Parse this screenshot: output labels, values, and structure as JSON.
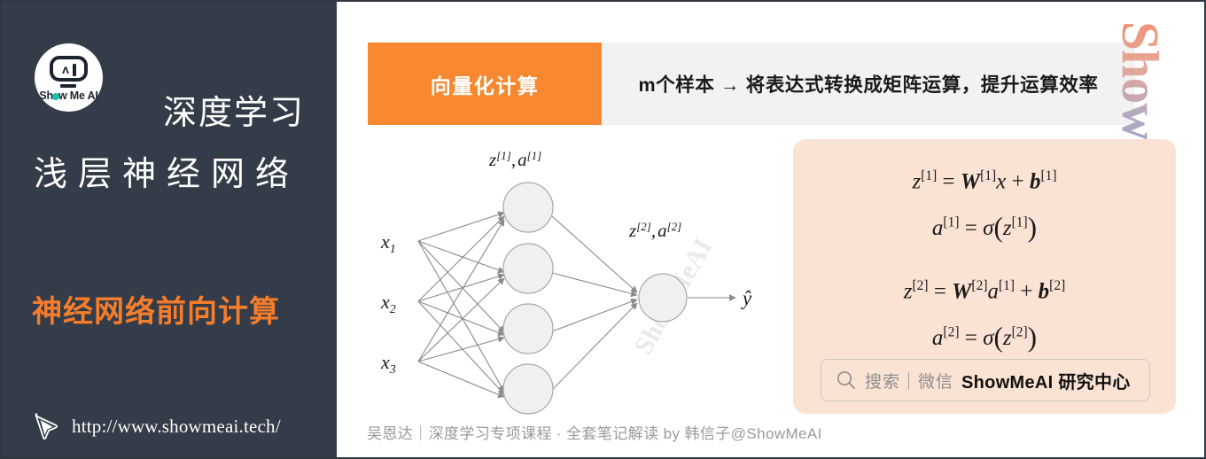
{
  "sidebar": {
    "logo": {
      "brand_prefix": "Sh",
      "brand_suffix": "w Me AI",
      "face_letter": "ʌ"
    },
    "title_main": "深度学习",
    "title_sub": "浅层神经网络",
    "title_topic": "神经网络前向计算",
    "url": "http://www.showmeai.tech/"
  },
  "banner": {
    "tag": "向量化计算",
    "description": "m个样本 → 将表达式转换成矩阵运算，提升运算效率"
  },
  "watermark": {
    "text": "ShowMeAI"
  },
  "diagram": {
    "inputs": [
      "x",
      "x",
      "x"
    ],
    "input_subscripts": [
      "1",
      "2",
      "3"
    ],
    "hidden_label_base": "z",
    "hidden_label": "z[1], a[1]",
    "output_label": "z[2], a[2]",
    "output_value": "ŷ",
    "hidden_node_count": 4,
    "output_node_count": 1,
    "node_fill": "#f0f0f0",
    "node_stroke": "#a8a8a8",
    "edge_color": "#8a8a8a",
    "watermark_text": "ShowMeAI"
  },
  "formulas": {
    "line1": {
      "lhs": "z",
      "lhs_sup": "[1]",
      "eq": "=",
      "w": "W",
      "w_sup": "[1]",
      "operand": "x",
      "plus": "+",
      "b": "b",
      "b_sup": "[1]"
    },
    "line2": {
      "lhs": "a",
      "lhs_sup": "[1]",
      "eq": "=",
      "fn": "σ",
      "arg": "z",
      "arg_sup": "[1]"
    },
    "line3": {
      "lhs": "z",
      "lhs_sup": "[2]",
      "eq": "=",
      "w": "W",
      "w_sup": "[2]",
      "operand": "a",
      "operand_sup": "[1]",
      "plus": "+",
      "b": "b",
      "b_sup": "[2]"
    },
    "line4": {
      "lhs": "a",
      "lhs_sup": "[2]",
      "eq": "=",
      "fn": "σ",
      "arg": "z",
      "arg_sup": "[2]"
    }
  },
  "search_bar": {
    "hint": "搜索｜微信",
    "brand": "ShowMeAI 研究中心"
  },
  "footer": {
    "text": "吴恩达｜深度学习专项课程 · 全套笔记解读  by 韩信子@ShowMeAI"
  },
  "colors": {
    "sidebar_bg": "#333c48",
    "accent_orange": "#f57d2b",
    "banner_orange": "#f7882f",
    "banner_gray": "#f2f2f2",
    "panel_peach": "#fbe3d4"
  }
}
